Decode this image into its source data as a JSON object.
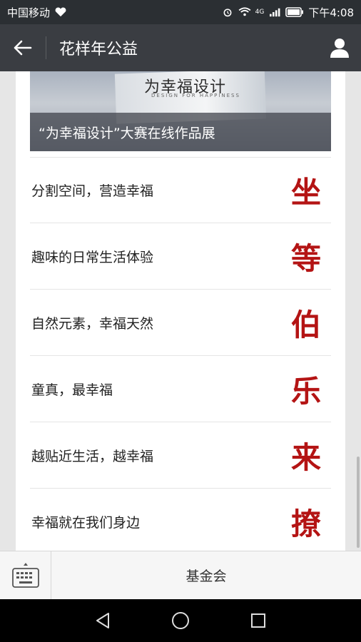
{
  "status_bar": {
    "carrier": "中国移动",
    "network": "4G",
    "time": "下午4:08"
  },
  "title_bar": {
    "title": "花样年公益",
    "back_icon": "back-arrow-icon",
    "user_icon": "user-profile-icon"
  },
  "hero": {
    "book_title": "为幸福设计",
    "book_subtitle": "DESIGN FOR HAPPINESS",
    "caption": "“为幸福设计”大赛在线作品展"
  },
  "list": [
    {
      "label": "分割空间，营造幸福",
      "char": "坐"
    },
    {
      "label": "趣味的日常生活体验",
      "char": "等"
    },
    {
      "label": "自然元素，幸福天然",
      "char": "伯"
    },
    {
      "label": "童真，最幸福",
      "char": "乐"
    },
    {
      "label": "越贴近生活，越幸福",
      "char": "来"
    },
    {
      "label": "幸福就在我们身边",
      "char": "撩"
    }
  ],
  "bottom_menu": {
    "keyboard_icon": "keyboard-icon",
    "menu_label": "基金会"
  },
  "nav_bar": {
    "back_icon": "triangle-back-icon",
    "home_icon": "circle-home-icon",
    "recent_icon": "square-recent-icon"
  },
  "colors": {
    "accent_red": "#b41414",
    "title_bar": "#3a3d42",
    "status_bar": "#2b2f33"
  }
}
